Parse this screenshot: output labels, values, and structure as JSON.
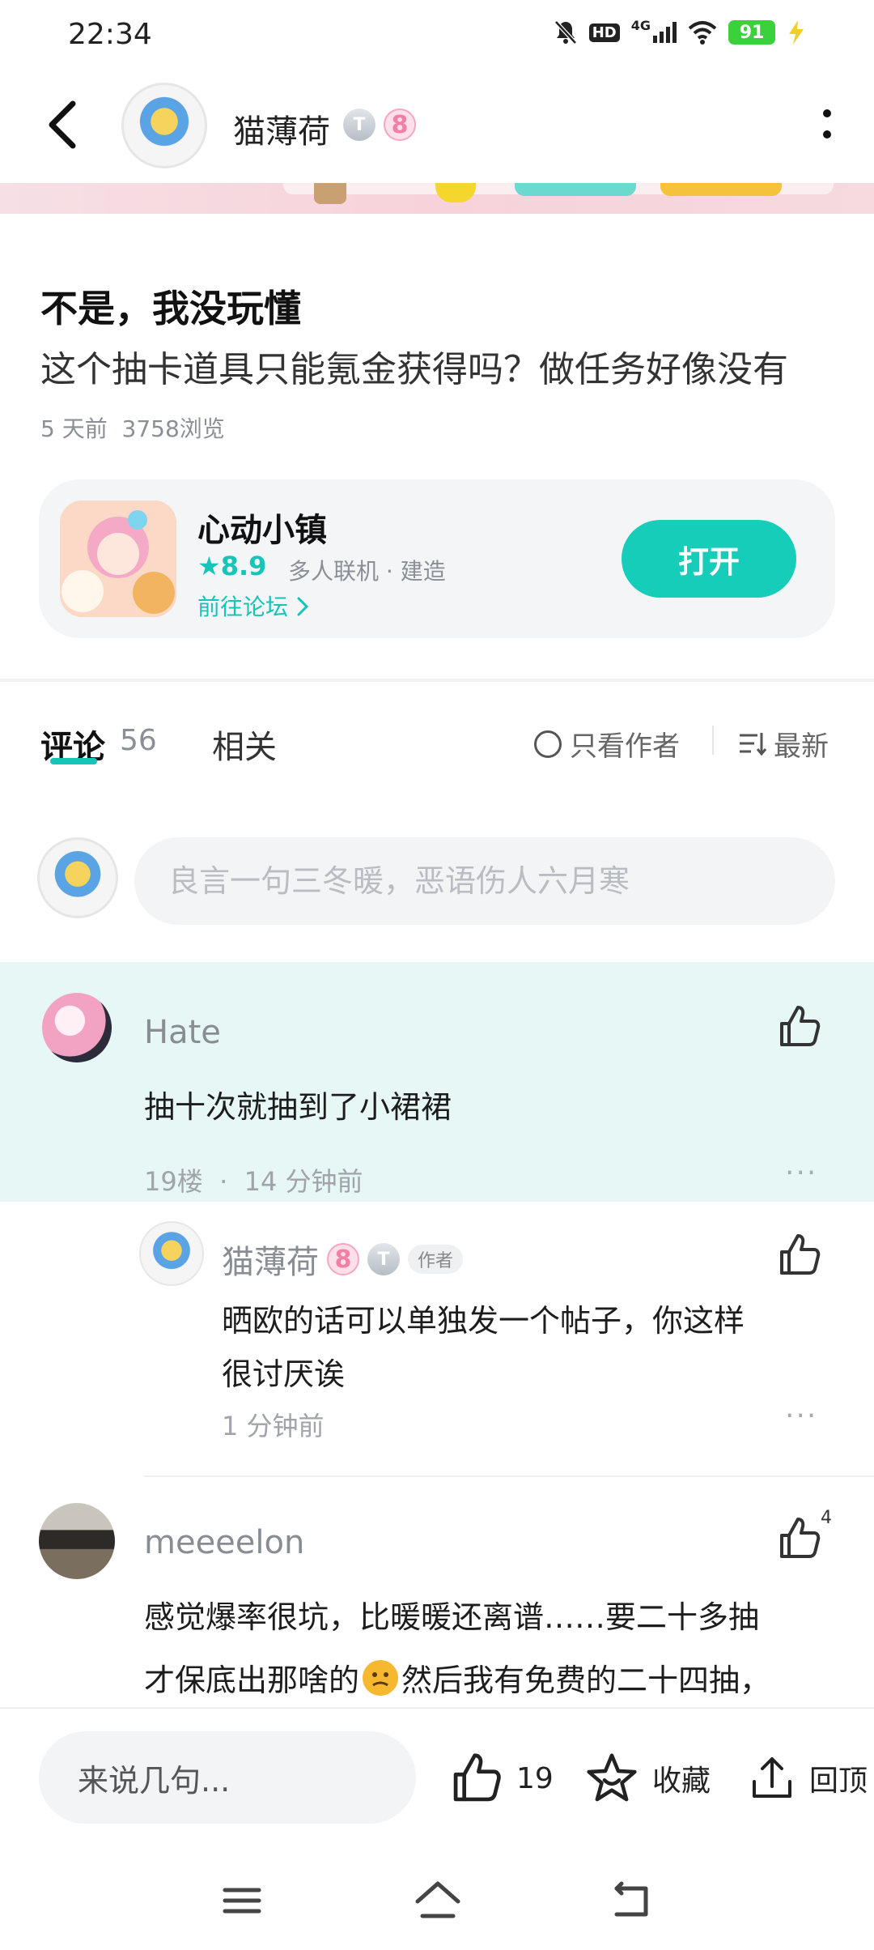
{
  "status_bar": {
    "time": "22:34",
    "battery": "91",
    "network": "4G",
    "hd": "HD"
  },
  "header": {
    "username": "猫薄荷",
    "badge_t": "T",
    "badge_level": "8"
  },
  "post": {
    "title": "不是，我没玩懂",
    "body": "这个抽卡道具只能氪金获得吗？做任务好像没有",
    "time": "5 天前",
    "views": "3758浏览"
  },
  "app_card": {
    "name": "心动小镇",
    "rating": "8.9",
    "tags": "多人联机 · 建造",
    "forum_link": "前往论坛",
    "open_button": "打开"
  },
  "tabs": {
    "comments_label": "评论",
    "comments_count": "56",
    "related_label": "相关",
    "author_only": "只看作者",
    "sort_label": "最新"
  },
  "comment_input": {
    "placeholder": "良言一句三冬暖，恶语伤人六月寒"
  },
  "comments": [
    {
      "user": "Hate",
      "text": "抽十次就抽到了小裙裙",
      "floor": "19楼",
      "time": "14 分钟前",
      "dots": "···",
      "reply": {
        "user": "猫薄荷",
        "badge_level": "8",
        "badge_t": "T",
        "author_tag": "作者",
        "text_line1": "晒欧的话可以单独发一个帖子，你这样",
        "text_line2": "很讨厌诶",
        "time": "1 分钟前",
        "dots": "···"
      }
    },
    {
      "user": "meeeelon",
      "likes": "4",
      "text_line1": "感觉爆率很坑，比暖暖还离谱……要二十多抽",
      "text_line2a": "才保底出那啥的",
      "text_line2b": "然后我有免费的二十四抽，"
    }
  ],
  "bottom_bar": {
    "input_placeholder": "来说几句...",
    "like_count": "19",
    "collect_label": "收藏",
    "top_label": "回顶"
  }
}
